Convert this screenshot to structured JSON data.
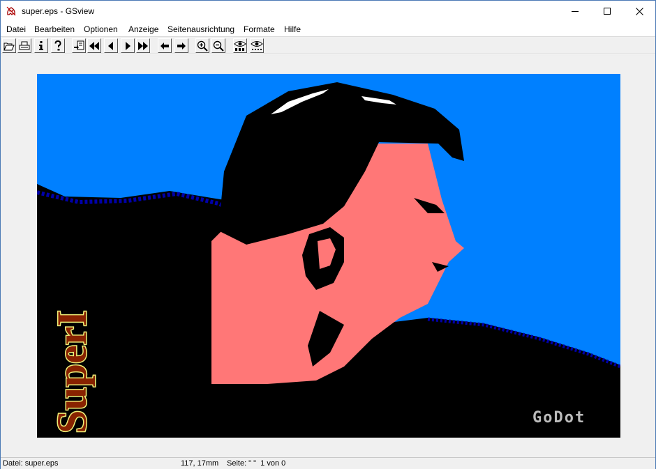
{
  "window": {
    "title": "super.eps - GSview",
    "icon": "gsview-ghost-icon"
  },
  "window_controls": {
    "minimize_icon": "minimize-icon",
    "maximize_icon": "maximize-icon",
    "close_icon": "close-icon"
  },
  "menubar": {
    "items": [
      "Datei",
      "Bearbeiten",
      "Optionen",
      "Anzeige",
      "Seitenausrichtung",
      "Formate",
      "Hilfe"
    ]
  },
  "toolbar": {
    "buttons": [
      {
        "name": "open-file-button",
        "icon": "folder-open-icon"
      },
      {
        "name": "print-button",
        "icon": "printer-icon"
      },
      {
        "name": "info-button",
        "icon": "info-icon"
      },
      {
        "name": "help-button",
        "icon": "question-icon"
      },
      {
        "name": "goto-page-button",
        "icon": "page-goto-icon"
      },
      {
        "name": "first-page-button",
        "icon": "double-left-icon"
      },
      {
        "name": "previous-page-button",
        "icon": "left-triangle-icon"
      },
      {
        "name": "next-page-button",
        "icon": "right-triangle-icon"
      },
      {
        "name": "last-page-button",
        "icon": "double-right-icon"
      },
      {
        "name": "back-button",
        "icon": "arrow-left-icon"
      },
      {
        "name": "forward-button",
        "icon": "arrow-right-icon"
      },
      {
        "name": "zoom-in-button",
        "icon": "zoom-in-icon"
      },
      {
        "name": "zoom-out-button",
        "icon": "zoom-out-icon"
      },
      {
        "name": "find-text-button",
        "icon": "eye-abc-icon"
      },
      {
        "name": "find-next-button",
        "icon": "eye-dots-icon"
      }
    ]
  },
  "document": {
    "image_name": "eps-preview-image",
    "overlay_text_left": "SuperI",
    "overlay_text_right": "GoDot",
    "colors": {
      "sky": "#0080ff",
      "skin": "#ff7777",
      "hair": "#000000",
      "shadow_blue": "#0000aa",
      "text_fill": "#882200",
      "text_outline": "#eeee77",
      "signature": "#bbbbbb"
    }
  },
  "statusbar": {
    "file": "Datei: super.eps",
    "coords": "117, 17mm",
    "page": "Seite: \" \"  1 von 0"
  }
}
